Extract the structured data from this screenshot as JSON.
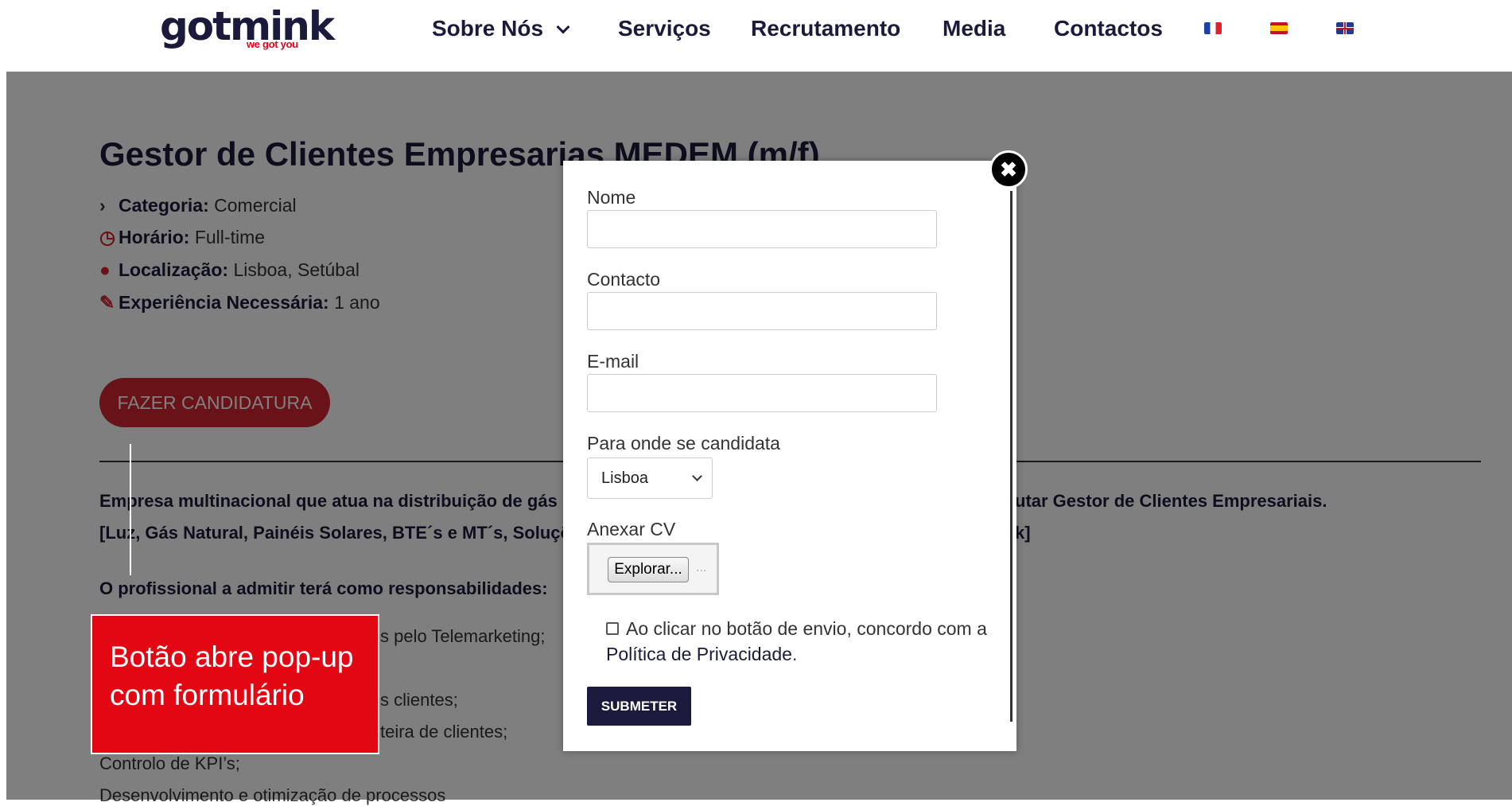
{
  "header": {
    "logo_word": "gotmink",
    "logo_tagline": "we got you",
    "nav": [
      "Sobre Nós",
      "Serviços",
      "Recrutamento",
      "Media",
      "Contactos"
    ],
    "flags": [
      "french-flag-icon",
      "spanish-flag-icon",
      "uk-flag-icon"
    ]
  },
  "job": {
    "title": "Gestor de Clientes Empresarias MEDEM (m/f)",
    "meta": [
      {
        "label": "Categoria:",
        "value": "Comercial",
        "icon": "chevron-right-icon"
      },
      {
        "label": "Horário:",
        "value": "Full-time",
        "icon": "clock-icon"
      },
      {
        "label": "Localização:",
        "value": "Lisboa, Setúbal",
        "icon": "map-pin-icon"
      },
      {
        "label": "Experiência Necessária:",
        "value": "1 ano",
        "icon": "wrench-icon"
      }
    ],
    "apply_label": "FAZER CANDIDATURA",
    "intro_left": "Empresa multinacional que atua na distribuição de gás",
    "intro_right": "utar Gestor de Clientes Empresariais.",
    "products_left": "[Luz, Gás Natural, Painéis Solares, BTE´s e MT´s, Soluçõ",
    "products_right": "k]",
    "responsibilities_heading": "O profissional a admitir terá como responsabilidades:",
    "responsibility_fragments": [
      "s pelo Telemarketing;",
      "s clientes;",
      "teira de clientes;",
      "Controlo de KPI’s;",
      "Desenvolvimento e otimização de processos"
    ]
  },
  "annotation": {
    "text_line1": "Botão abre pop-up",
    "text_line2": "com formulário"
  },
  "modal": {
    "close_symbol": "✖",
    "fields": {
      "name_label": "Nome",
      "contact_label": "Contacto",
      "email_label": "E-mail",
      "location_label": "Para onde se candidata",
      "location_selected": "Lisboa",
      "cv_label": "Anexar CV",
      "browse_label": "Explorar...",
      "file_placeholder": "..."
    },
    "consent_text": "Ao clicar no botão de envio, concordo com a",
    "consent_link": "Política de Privacidade",
    "consent_end": ".",
    "submit_label": "SUBMETER"
  }
}
